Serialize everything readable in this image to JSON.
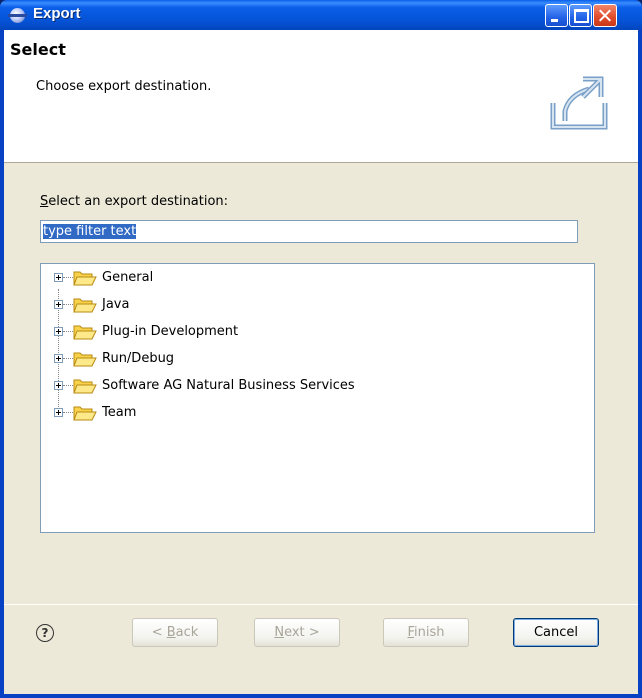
{
  "window": {
    "title": "Export"
  },
  "header": {
    "title": "Select",
    "description": "Choose export destination."
  },
  "section": {
    "label_prefix": "S",
    "label_rest": "elect an export destination:"
  },
  "filter": {
    "value": "type filter text"
  },
  "tree": {
    "items": [
      {
        "label": "General"
      },
      {
        "label": "Java"
      },
      {
        "label": "Plug-in Development"
      },
      {
        "label": "Run/Debug"
      },
      {
        "label": "Software AG Natural Business Services"
      },
      {
        "label": "Team"
      }
    ]
  },
  "buttons": {
    "help": "?",
    "back_prefix": "< ",
    "back_mnemonic": "B",
    "back_rest": "ack",
    "next_mnemonic": "N",
    "next_rest": "ext >",
    "finish_mnemonic": "F",
    "finish_rest": "inish",
    "cancel": "Cancel"
  },
  "colors": {
    "titlebar": "#0553d6",
    "folder": "#f8d24a",
    "selection": "#316ac5"
  }
}
